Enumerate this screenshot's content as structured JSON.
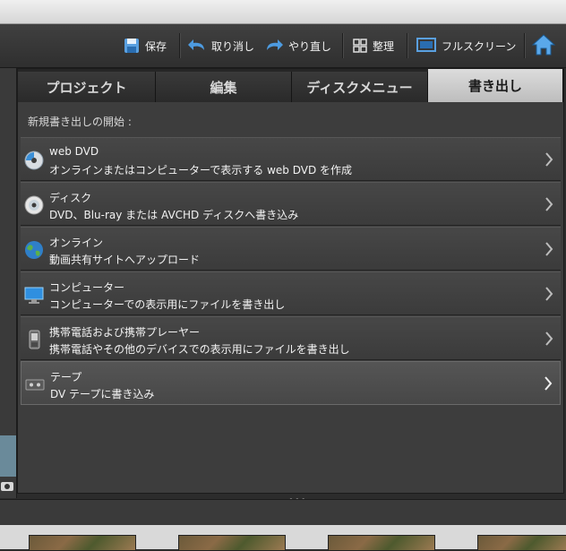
{
  "toolbar": {
    "save_label": "保存",
    "undo_label": "取り消し",
    "redo_label": "やり直し",
    "organize_label": "整理",
    "fullscreen_label": "フルスクリーン"
  },
  "tabs": [
    {
      "label": "プロジェクト",
      "active": false
    },
    {
      "label": "編集",
      "active": false
    },
    {
      "label": "ディスクメニュー",
      "active": false
    },
    {
      "label": "書き出し",
      "active": true
    }
  ],
  "export": {
    "section_label": "新規書き出しの開始 :",
    "items": [
      {
        "icon": "web-dvd-icon",
        "title": "web DVD",
        "description": "オンラインまたはコンピューターで表示する web DVD を作成"
      },
      {
        "icon": "disc-icon",
        "title": "ディスク",
        "description": "DVD、Blu-ray または AVCHD ディスクへ書き込み"
      },
      {
        "icon": "globe-icon",
        "title": "オンライン",
        "description": "動画共有サイトへアップロード"
      },
      {
        "icon": "monitor-icon",
        "title": "コンピューター",
        "description": "コンピューターでの表示用にファイルを書き出し"
      },
      {
        "icon": "mobile-phone-icon",
        "title": "携帯電話および携帯プレーヤー",
        "description": "携帯電話やその他のデバイスでの表示用にファイルを書き出し"
      },
      {
        "icon": "tape-icon",
        "title": "テープ",
        "description": "DV テープに書き込み"
      }
    ]
  },
  "colors": {
    "accent": "#3a8fd8",
    "panel": "#3d3d3d",
    "active_tab": "#cfcfcf"
  }
}
